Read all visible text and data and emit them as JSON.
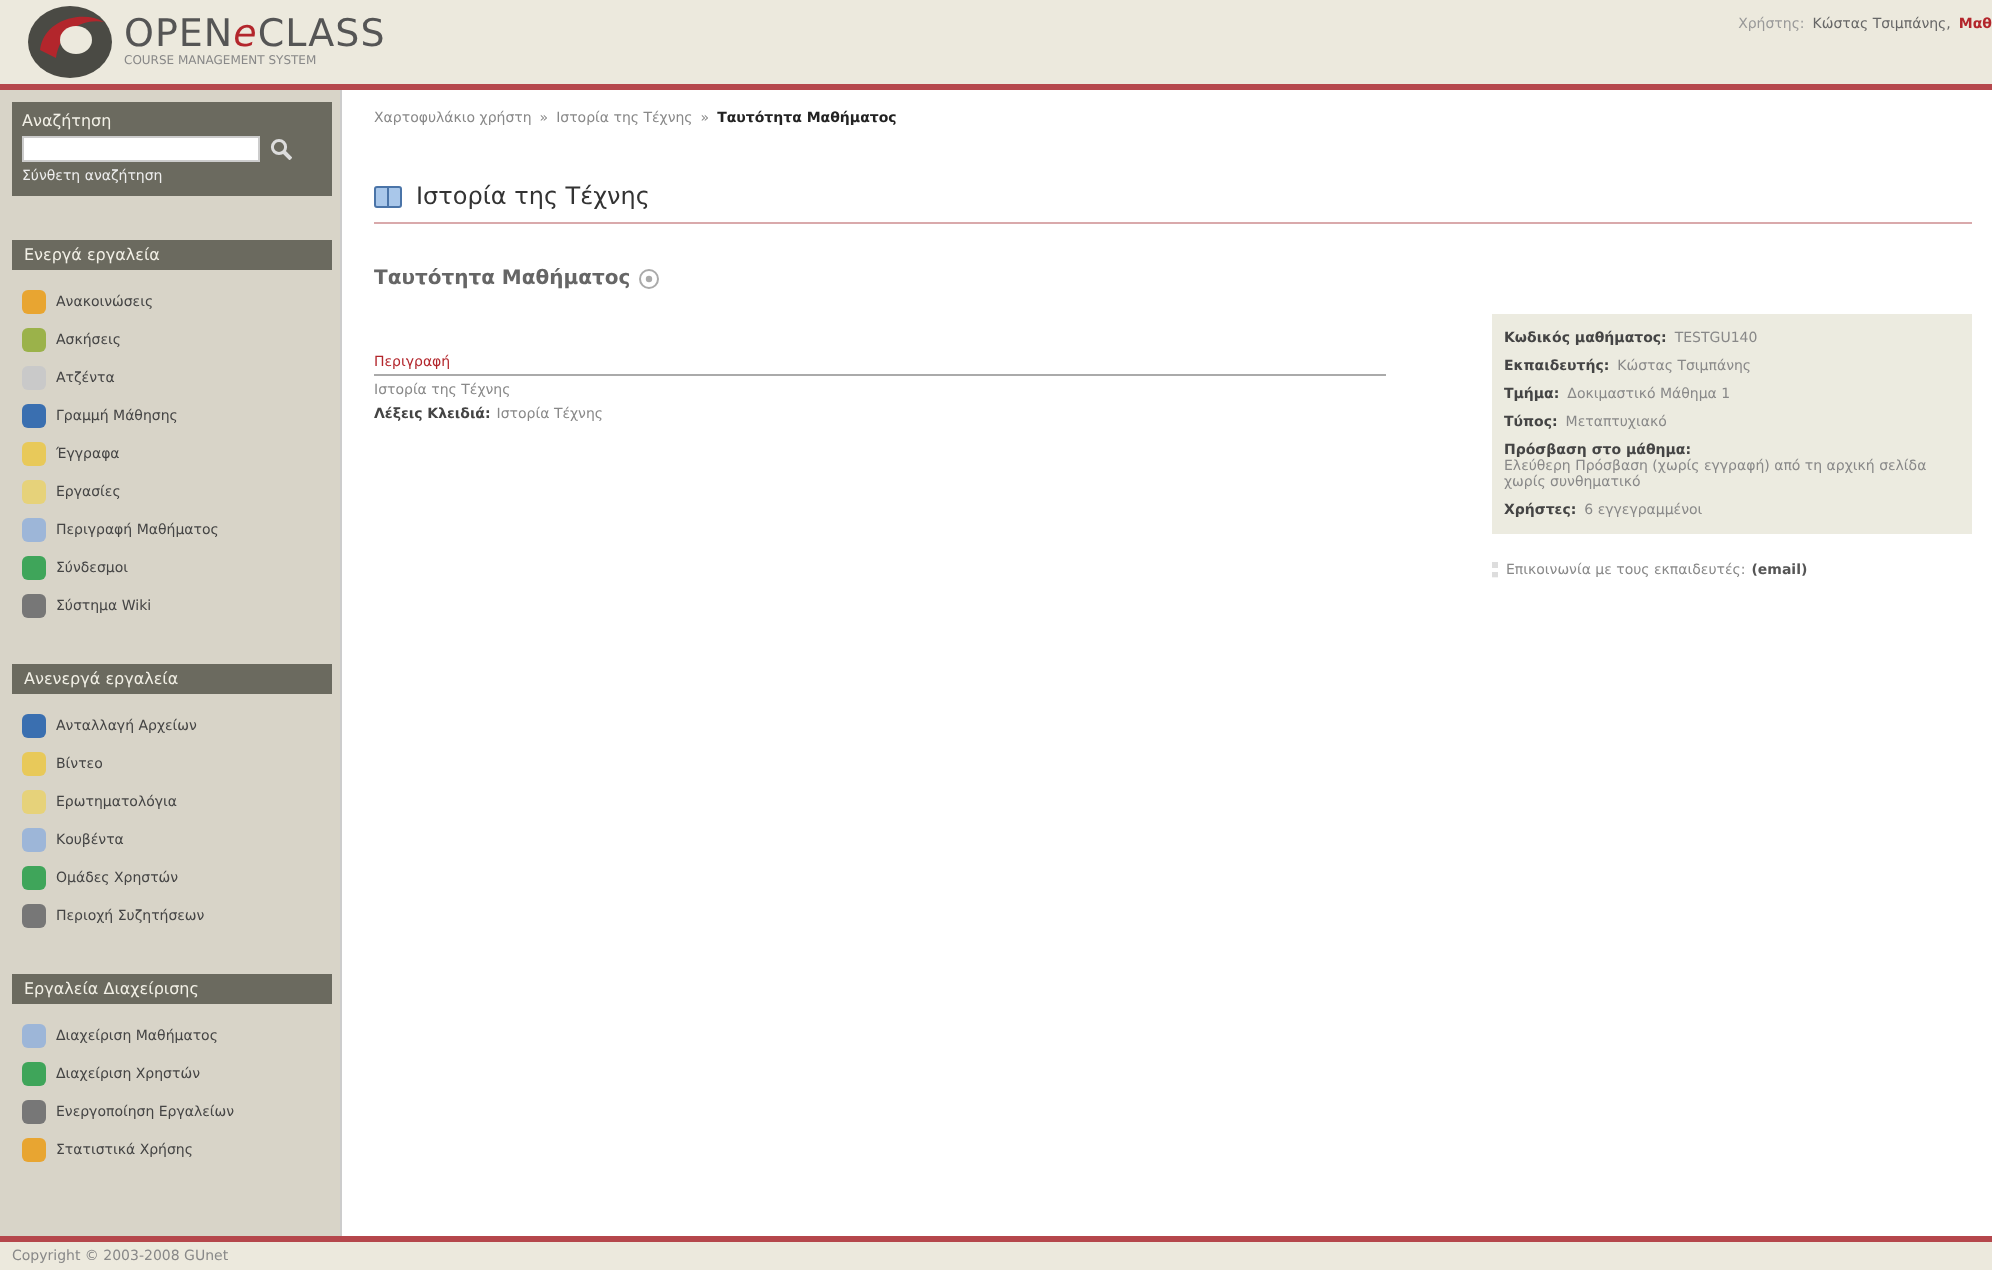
{
  "header": {
    "logo_main": "OPEN",
    "logo_e": "e",
    "logo_end": "CLASS",
    "logo_sub": "COURSE MANAGEMENT SYSTEM",
    "user_label": "Χρήστης:",
    "user_name": "Κώστας Τσιμπάνης,",
    "user_role": "Μαθ"
  },
  "search": {
    "title": "Αναζήτηση",
    "advanced": "Σύνθετη αναζήτηση"
  },
  "sidebar": [
    {
      "title": "Ενεργά εργαλεία",
      "items": [
        "Ανακοινώσεις",
        "Ασκήσεις",
        "Ατζέντα",
        "Γραμμή Μάθησης",
        "Έγγραφα",
        "Εργασίες",
        "Περιγραφή Μαθήματος",
        "Σύνδεσμοι",
        "Σύστημα Wiki"
      ]
    },
    {
      "title": "Ανενεργά εργαλεία",
      "items": [
        "Ανταλλαγή Αρχείων",
        "Βίντεο",
        "Ερωτηματολόγια",
        "Κουβέντα",
        "Ομάδες Χρηστών",
        "Περιοχή Συζητήσεων"
      ]
    },
    {
      "title": "Εργαλεία Διαχείρισης",
      "items": [
        "Διαχείριση Μαθήματος",
        "Διαχείριση Χρηστών",
        "Ενεργοποίηση Εργαλείων",
        "Στατιστικά Χρήσης"
      ]
    }
  ],
  "breadcrumb": [
    {
      "label": "Χαρτοφυλάκιο χρήστη",
      "current": false
    },
    {
      "label": "Ιστορία της Τέχνης",
      "current": false
    },
    {
      "label": "Ταυτότητα Μαθήματος",
      "current": true
    }
  ],
  "breadcrumb_sep": "»",
  "course_title": "Ιστορία της Τέχνης",
  "section_title": "Ταυτότητα Μαθήματος",
  "description": {
    "heading": "Περιγραφή",
    "text": "Ιστορία της Τέχνης",
    "keywords_label": "Λέξεις Κλειδιά:",
    "keywords": "Ιστορία Τέχνης"
  },
  "info": [
    {
      "label": "Κωδικός μαθήματος:",
      "value": "TESTGU140"
    },
    {
      "label": "Εκπαιδευτής:",
      "value": "Κώστας Τσιμπάνης"
    },
    {
      "label": "Τμήμα:",
      "value": "Δοκιμαστικό Μάθημα 1"
    },
    {
      "label": "Τύπος:",
      "value": "Μεταπτυχιακό"
    },
    {
      "label": "Πρόσβαση στο μάθημα:",
      "value": "Ελεύθερη Πρόσβαση (χωρίς εγγραφή) από τη αρχική σελίδα χωρίς συνθηματικό"
    },
    {
      "label": "Χρήστες:",
      "value": "6 εγγεγραμμένοι"
    }
  ],
  "contact": {
    "text": "Επικοινωνία με τους εκπαιδευτές:",
    "link": "(email)"
  },
  "footer": "Copyright © 2003-2008 GUnet"
}
